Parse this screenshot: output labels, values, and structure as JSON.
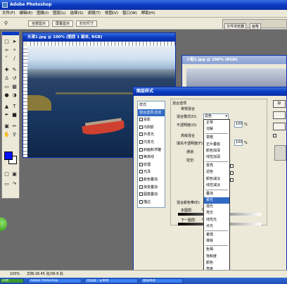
{
  "app": {
    "title": "Adobe Photoshop"
  },
  "menu": [
    "文件(F)",
    "编辑(E)",
    "图像(I)",
    "图层(L)",
    "选择(S)",
    "滤镜(T)",
    "视图(V)",
    "窗口(W)",
    "帮助(H)"
  ],
  "options": {
    "btn1": "全部显示",
    "btn2": "屏幕显示",
    "btn3": "打印尺寸",
    "tab1": "文件浏览器",
    "tab2": "画笔"
  },
  "doc1": {
    "title": "水滴1.jpg @ 100% (图层 1 副本, RGB)"
  },
  "doc2": {
    "title": "小船1.jpg @ 100% (RGB)"
  },
  "dialog": {
    "title": "图层样式",
    "styles": [
      "样式",
      "混合选项:自定",
      "投影",
      "内阴影",
      "外发光",
      "内发光",
      "斜面和浮雕",
      "等高线",
      "纹理",
      "光泽",
      "颜色叠加",
      "渐变叠加",
      "图案叠加",
      "描边"
    ],
    "blend_group": "混合选项",
    "general_group": "常规混合",
    "blend_mode_label": "混合模式(D):",
    "blend_mode_value": "滤色",
    "opacity_label": "不透明度(O):",
    "opacity_value": "100",
    "percent": "%",
    "advanced_group": "高级混合",
    "fill_label": "填充不透明度(F):",
    "fill_value": "100",
    "channel_label": "通道:",
    "knockout_label": "挖空:",
    "blendif_label": "混合颜色带(E):",
    "blendif_value": "灰色",
    "this_layer": "本图层:",
    "under_layer": "下一图层:",
    "this_layer_min": "0",
    "under_layer_min": "0",
    "ok": "好",
    "new_style_label": "新建样式"
  },
  "dropdown": {
    "items": [
      "正常",
      "溶解",
      "---",
      "变暗",
      "正片叠底",
      "颜色加深",
      "线性加深",
      "---",
      "变亮",
      "滤色",
      "颜色减淡",
      "线性减淡",
      "---",
      "叠加",
      "柔光",
      "强光",
      "亮光",
      "线性光",
      "点光",
      "---",
      "差值",
      "排除",
      "---",
      "色相",
      "饱和度",
      "颜色",
      "亮度"
    ],
    "highlight": "柔光"
  },
  "status": {
    "zoom": "100%",
    "doc": "文档:18.45 兆/36.9 兆"
  },
  "taskbar": [
    "开始",
    "Adobe Photoshop",
    "无标题 - 记事本",
    "图层样式"
  ]
}
